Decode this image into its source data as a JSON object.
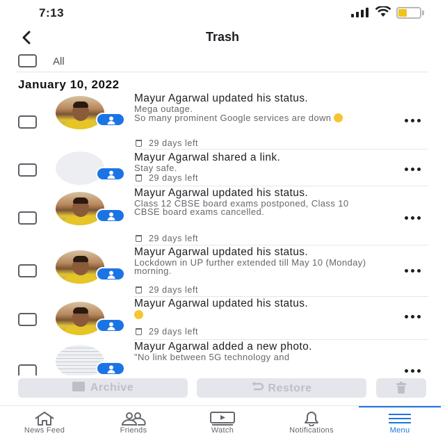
{
  "status_bar": {
    "time": "7:13"
  },
  "header": {
    "title": "Trash",
    "back_icon": "chevron-left-icon"
  },
  "select_all": {
    "label": "All"
  },
  "date_header": "January 10, 2022",
  "items": [
    {
      "title": "Mayur Agarwal updated his status.",
      "body": "Mega outage.\nSo many prominent Google services are down",
      "has_emoji": true,
      "days": "29 days left",
      "avatar": "photo"
    },
    {
      "title": "Mayur Agarwal shared a link.",
      "body": "Stay safe.",
      "has_emoji": false,
      "days": "29 days left",
      "avatar": "blank"
    },
    {
      "title": "Mayur Agarwal updated his status.",
      "body": "Class 12 CBSE board exams postponed, Class 10 CBSE board exams cancelled.",
      "has_emoji": false,
      "days": "29 days left",
      "avatar": "photo"
    },
    {
      "title": "Mayur Agarwal updated his status.",
      "body": "Lockdown in UP further extended till May 10 (Monday) morning.",
      "has_emoji": false,
      "days": "29 days left",
      "avatar": "photo"
    },
    {
      "title": "Mayur Agarwal updated his status.",
      "body": "",
      "has_emoji": true,
      "days": "29 days left",
      "avatar": "photo"
    },
    {
      "title": "Mayur Agarwal added a new photo.",
      "body": "\"No link between 5G technology and",
      "has_emoji": false,
      "days": "",
      "avatar": "document"
    }
  ],
  "actions": {
    "archive": "Archive",
    "restore": "Restore"
  },
  "nav": [
    {
      "label": "News Feed",
      "icon": "home-icon"
    },
    {
      "label": "Friends",
      "icon": "friends-icon"
    },
    {
      "label": "Watch",
      "icon": "watch-icon"
    },
    {
      "label": "Notifications",
      "icon": "bell-icon"
    },
    {
      "label": "Menu",
      "icon": "menu-icon",
      "active": true
    }
  ],
  "colors": {
    "accent": "#1b74e4",
    "text": "#1c1e21",
    "secondary": "#65676b",
    "battery": "#f0c419"
  }
}
